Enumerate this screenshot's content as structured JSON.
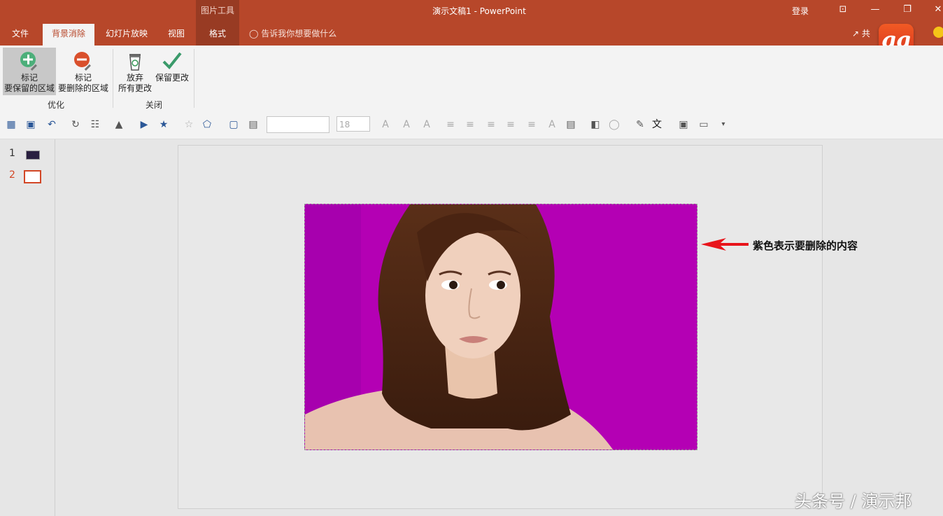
{
  "window": {
    "contextual_group": "图片工具",
    "title": "演示文稿1  -  PowerPoint",
    "signin": "登录",
    "controls": {
      "ribbon_display": "⊡",
      "minimize": "—",
      "restore": "❐",
      "close": "✕"
    }
  },
  "tabs": [
    {
      "label": "文件"
    },
    {
      "label": "背景消除",
      "active": true
    },
    {
      "label": "幻灯片放映"
    },
    {
      "label": "视图"
    },
    {
      "label": "格式"
    }
  ],
  "tellme": "告诉我你想要做什么",
  "share": "共",
  "logo_text": "gg",
  "ribbon": {
    "mark_keep": {
      "line1": "标记",
      "line2": "要保留的区域"
    },
    "mark_remove": {
      "line1": "标记",
      "line2": "要删除的区域"
    },
    "discard": {
      "line1": "放弃",
      "line2": "所有更改"
    },
    "keep_changes": {
      "line1": "保留更改"
    },
    "group_refine": "优化",
    "group_close": "关闭"
  },
  "toolbar": {
    "font_name": "",
    "font_size": "18"
  },
  "slides": [
    {
      "number": "1"
    },
    {
      "number": "2",
      "selected": true
    }
  ],
  "annotation": "紫色表示要删除的内容",
  "watermark": "头条号 / 演示邦",
  "colors": {
    "accent": "#b7472a",
    "removal_overlay": "#b400b4",
    "arrow": "#e8141b"
  }
}
